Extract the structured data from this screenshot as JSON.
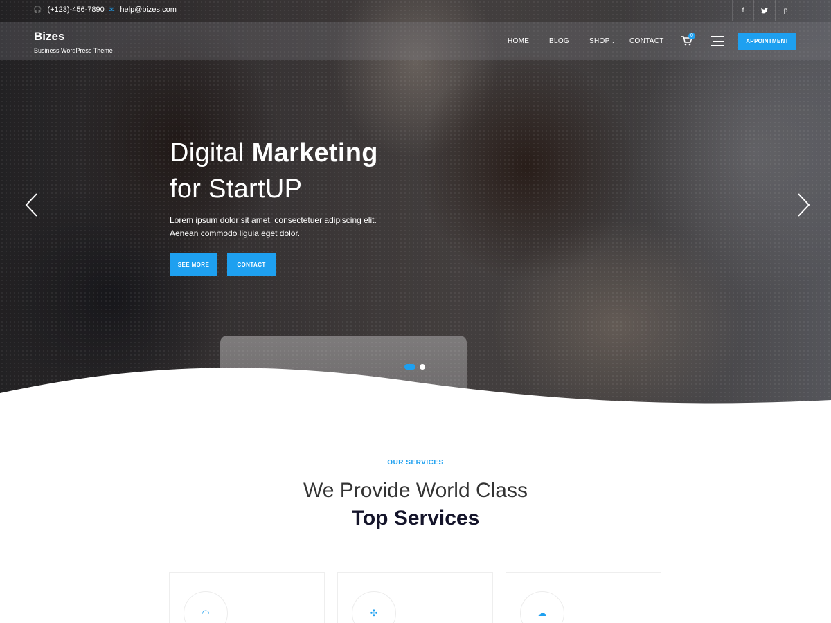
{
  "topbar": {
    "phone": "(+123)-456-7890",
    "email": "help@bizes.com",
    "social": [
      {
        "icon": "facebook-icon",
        "glyph": "f"
      },
      {
        "icon": "twitter-icon",
        "glyph": "🐦"
      },
      {
        "icon": "pinterest-icon",
        "glyph": "p"
      }
    ]
  },
  "brand": {
    "name": "Bizes",
    "tagline": "Business WordPress Theme"
  },
  "nav": {
    "items": [
      "HOME",
      "BLOG",
      "SHOP",
      "CONTACT"
    ],
    "cart_count": "0",
    "cta": "APPOINTMENT"
  },
  "hero": {
    "headline_light": "Digital ",
    "headline_bold": "Marketing",
    "headline_line2": "for StartUP",
    "desc_line1": "Lorem ipsum dolor sit amet, consectetuer adipiscing elit.",
    "desc_line2": "Aenean commodo ligula eget dolor.",
    "btn_primary": "SEE MORE",
    "btn_secondary": "CONTACT",
    "slides_total": 2,
    "slide_active": 1
  },
  "services": {
    "eyebrow": "OUR SERVICES",
    "title_light": "We Provide World Class",
    "title_bold": "Top Services",
    "cards": [
      {
        "icon": "speed-gauge-icon",
        "glyph": "◠"
      },
      {
        "icon": "network-icon",
        "glyph": "✣"
      },
      {
        "icon": "cloud-upload-icon",
        "glyph": "☁"
      }
    ]
  },
  "colors": {
    "accent": "#1ea0f0",
    "heading": "#14142a"
  }
}
